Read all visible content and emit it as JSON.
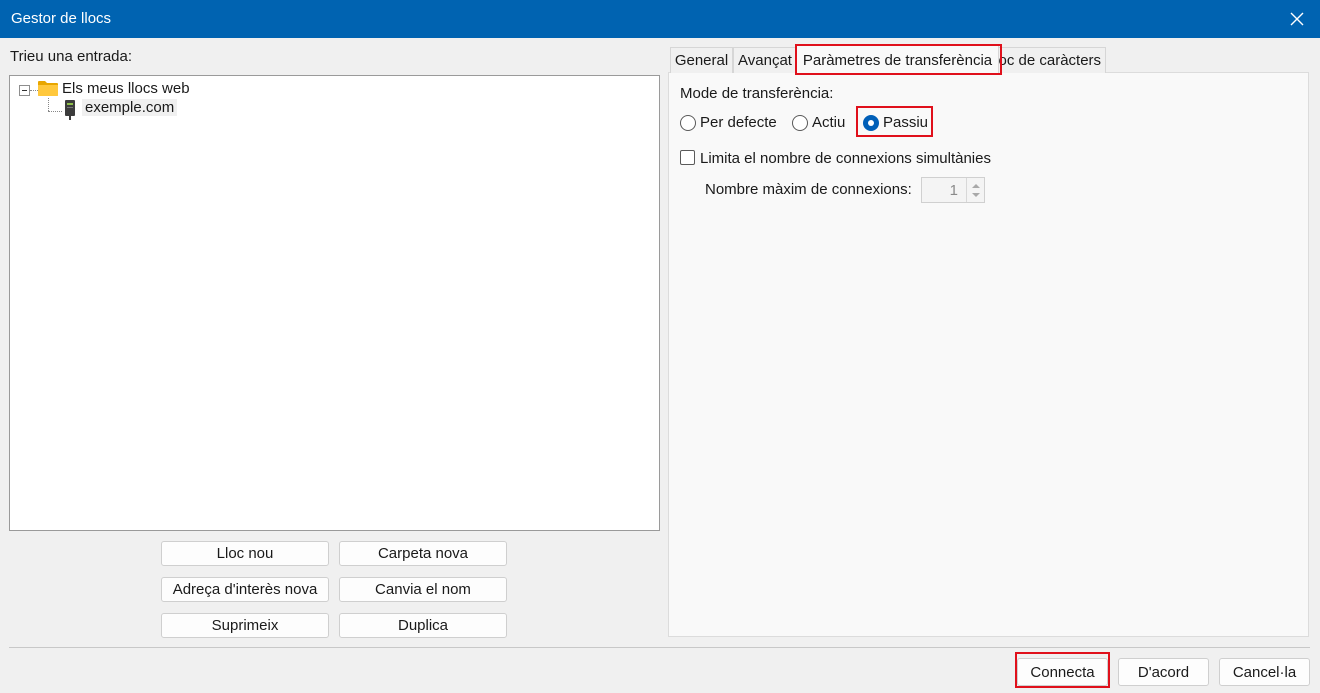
{
  "window": {
    "title": "Gestor de llocs"
  },
  "left": {
    "prompt": "Trieu una entrada:",
    "tree": {
      "root_label": "Els meus llocs web",
      "child_label": "exemple.com"
    },
    "buttons": {
      "new_site": "Lloc nou",
      "new_folder": "Carpeta nova",
      "new_bookmark": "Adreça d'interès nova",
      "rename": "Canvia el nom",
      "delete": "Suprimeix",
      "duplicate": "Duplica"
    }
  },
  "tabs": {
    "general": "General",
    "advanced": "Avançat",
    "transfer": "Paràmetres de transferència",
    "charset": "Joc de caràcters"
  },
  "transfer": {
    "mode_label": "Mode de transferència:",
    "mode_default": "Per defecte",
    "mode_active": "Actiu",
    "mode_passive": "Passiu",
    "selected_mode": "Passiu",
    "limit_label": "Limita el nombre de connexions simultànies",
    "limit_checked": false,
    "max_label": "Nombre màxim de connexions:",
    "max_value": "1"
  },
  "footer": {
    "connect": "Connecta",
    "ok": "D'acord",
    "cancel": "Cancel·la"
  },
  "colors": {
    "titlebar": "#0063b1",
    "accent": "#005fb8",
    "highlight": "#e0101b"
  }
}
